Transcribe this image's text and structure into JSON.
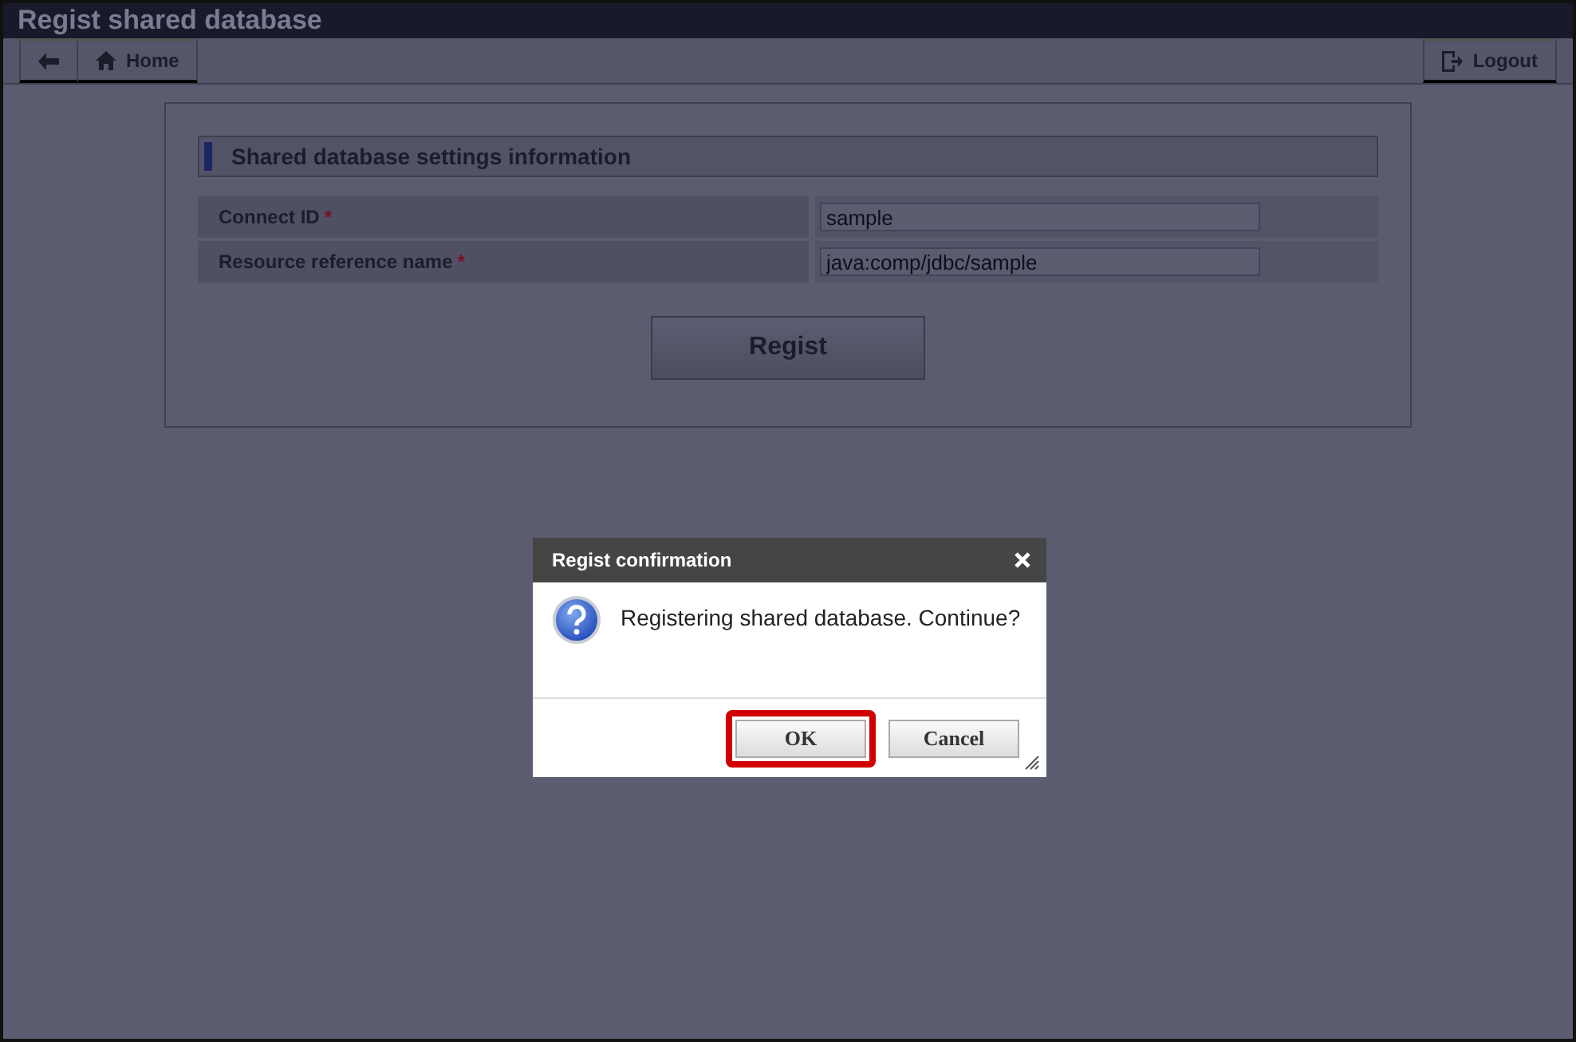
{
  "window": {
    "title": "Regist shared database"
  },
  "toolbar": {
    "home": "Home",
    "logout": "Logout"
  },
  "panel": {
    "heading": "Shared database settings information",
    "fields": [
      {
        "label": "Connect ID",
        "required_mark": "*",
        "value": "sample"
      },
      {
        "label": "Resource reference name",
        "required_mark": "*",
        "value": "java:comp/jdbc/sample"
      }
    ],
    "submit": "Regist"
  },
  "dialog": {
    "title": "Regist confirmation",
    "message": "Registering shared database. Continue?",
    "buttons": [
      {
        "label": "OK",
        "highlighted": true
      },
      {
        "label": "Cancel",
        "highlighted": false
      }
    ]
  }
}
